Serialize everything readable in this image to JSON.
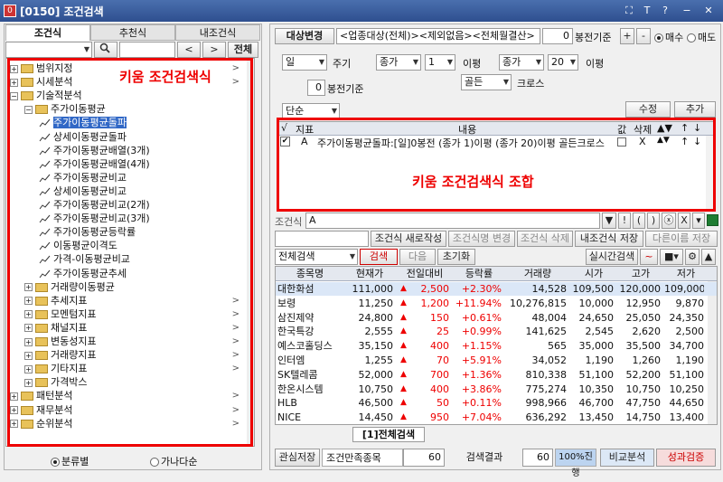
{
  "window": {
    "title": "[0150] 조건검색",
    "icon": "0",
    "controls": [
      "⛶",
      "T",
      "?",
      "−",
      "✕"
    ]
  },
  "left": {
    "tabs": [
      "조건식",
      "추천식",
      "내조건식"
    ],
    "search_btn": "🔍",
    "prev": "<",
    "next": ">",
    "all": "전체",
    "tree": [
      {
        "label": "범위지정",
        "type": "folder",
        "exp": "+",
        "arrow": ">"
      },
      {
        "label": "시세분석",
        "type": "folder",
        "exp": "+",
        "arrow": ">"
      },
      {
        "label": "기술적분석",
        "type": "folder",
        "exp": "−",
        "arrow": ""
      },
      {
        "label": "주가이동평균",
        "type": "folder",
        "exp": "−",
        "arrow": ""
      },
      {
        "label": "주가이동평균돌파",
        "type": "leaf",
        "sel": true
      },
      {
        "label": "상세이동평균돌파",
        "type": "leaf"
      },
      {
        "label": "주가이동평균배열(3개)",
        "type": "leaf"
      },
      {
        "label": "주가이동평균배열(4개)",
        "type": "leaf"
      },
      {
        "label": "주가이동평균비교",
        "type": "leaf"
      },
      {
        "label": "상세이동평균비교",
        "type": "leaf"
      },
      {
        "label": "주가이동평균비교(2개)",
        "type": "leaf"
      },
      {
        "label": "주가이동평균비교(3개)",
        "type": "leaf"
      },
      {
        "label": "주가이동평균등락률",
        "type": "leaf"
      },
      {
        "label": "이동평균이격도",
        "type": "leaf"
      },
      {
        "label": "가격-이동평균비교",
        "type": "leaf"
      },
      {
        "label": "주가이동평균추세",
        "type": "leaf"
      },
      {
        "label": "거래량이동평균",
        "type": "folder",
        "exp": "+",
        "arrow": ""
      },
      {
        "label": "추세지표",
        "type": "folder",
        "exp": "+",
        "arrow": ">"
      },
      {
        "label": "모멘텀지표",
        "type": "folder",
        "exp": "+",
        "arrow": ">"
      },
      {
        "label": "채널지표",
        "type": "folder",
        "exp": "+",
        "arrow": ">"
      },
      {
        "label": "변동성지표",
        "type": "folder",
        "exp": "+",
        "arrow": ">"
      },
      {
        "label": "거래량지표",
        "type": "folder",
        "exp": "+",
        "arrow": ">"
      },
      {
        "label": "기타지표",
        "type": "folder",
        "exp": "+",
        "arrow": ">"
      },
      {
        "label": "가격박스",
        "type": "folder",
        "exp": "+",
        "arrow": ""
      },
      {
        "label": "패턴분석",
        "type": "folder",
        "exp": "+",
        "arrow": ">"
      },
      {
        "label": "재무분석",
        "type": "folder",
        "exp": "+",
        "arrow": ">"
      },
      {
        "label": "순위분석",
        "type": "folder",
        "exp": "+",
        "arrow": ">"
      }
    ],
    "annotation": "키움 조건검색식",
    "radio1": "분류별",
    "radio2": "가나다순"
  },
  "right": {
    "target_btn": "대상변경",
    "target_text": "<업종대상(전체)><제외없음><전체월결산>",
    "base_num": "0",
    "base_label": "봉전기준",
    "plus": "+",
    "minus": "-",
    "buy": "매수",
    "sell": "매도",
    "period": "일",
    "period_label": "주기",
    "price1": "종가",
    "val1": "1",
    "lbl1": "이평",
    "price2": "종가",
    "val2": "20",
    "lbl2": "이평",
    "bong_num": "0",
    "bong_label": "봉전기준",
    "cross": "골든",
    "cross_label": "크로스",
    "simple": "단순",
    "edit": "수정",
    "add": "추가",
    "cond_headers": [
      "√",
      "지표",
      "내용",
      "값",
      "삭제",
      "▲▼",
      "↑",
      "↓"
    ],
    "cond_row": {
      "check": "✔",
      "idx": "A",
      "content": "주가이동평균돌파:[일]0봉전 (종가 1)이평 (종가 20)이평 골든크로스",
      "del": "X",
      "ud": "▲▼",
      "up": "↑",
      "down": "↓"
    },
    "annotation": "키움 조건검색식 조합",
    "formula_label": "조건식",
    "formula_val": "A",
    "sym_btns": [
      "▼",
      "!",
      "(",
      ")",
      "ⓧ",
      "X",
      "▾"
    ],
    "btns": [
      "조건식 새로작성",
      "조건식명 변경",
      "조건식 삭제",
      "내조건식 저장",
      "다른이름 저장"
    ],
    "result_select": "전체검색",
    "search": "검색",
    "next": "다음",
    "reset": "초기화",
    "realtime": "실시간검색",
    "columns": [
      "종목명",
      "현재가",
      "전일대비",
      "등락률",
      "거래량",
      "시가",
      "고가",
      "저가"
    ],
    "rows": [
      [
        "대한화섬",
        "111,000",
        "2,500",
        "+2.30%",
        "14,528",
        "109,500",
        "120,000",
        "109,000"
      ],
      [
        "보령",
        "11,250",
        "1,200",
        "+11.94%",
        "10,276,815",
        "10,000",
        "12,950",
        "9,870"
      ],
      [
        "삼진제약",
        "24,800",
        "150",
        "+0.61%",
        "48,004",
        "24,650",
        "25,050",
        "24,350"
      ],
      [
        "한국특강",
        "2,555",
        "25",
        "+0.99%",
        "141,625",
        "2,545",
        "2,620",
        "2,500"
      ],
      [
        "예스코홀딩스",
        "35,150",
        "400",
        "+1.15%",
        "565",
        "35,000",
        "35,500",
        "34,700"
      ],
      [
        "인터엠",
        "1,255",
        "70",
        "+5.91%",
        "34,052",
        "1,190",
        "1,260",
        "1,190"
      ],
      [
        "SK텔레콤",
        "52,000",
        "700",
        "+1.36%",
        "810,338",
        "51,100",
        "52,200",
        "51,100"
      ],
      [
        "한온시스템",
        "10,750",
        "400",
        "+3.86%",
        "775,274",
        "10,350",
        "10,750",
        "10,250"
      ],
      [
        "HLB",
        "46,500",
        "50",
        "+0.11%",
        "998,966",
        "46,700",
        "47,750",
        "44,650"
      ],
      [
        "NICE",
        "14,450",
        "950",
        "+7.04%",
        "636,292",
        "13,450",
        "14,750",
        "13,400"
      ]
    ],
    "bottom_tab": "[1]전체검색",
    "save_interest": "관심저장",
    "cond_count_label": "조건만족종목",
    "cond_count": "60",
    "result_label": "검색결과",
    "result_count": "60",
    "progress_label": "100%진행",
    "progress": 1.0,
    "compare": "비교분석",
    "perf": "성과검증"
  }
}
